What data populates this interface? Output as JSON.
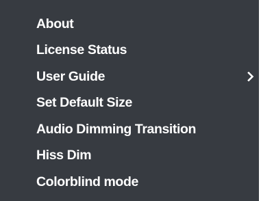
{
  "menu": {
    "items": [
      {
        "label": "About",
        "has_submenu": false
      },
      {
        "label": "License Status",
        "has_submenu": false
      },
      {
        "label": "User Guide",
        "has_submenu": true,
        "submenu_icon": "chevron-right-icon"
      },
      {
        "label": "Set Default Size",
        "has_submenu": false
      },
      {
        "label": "Audio Dimming Transition",
        "has_submenu": false
      },
      {
        "label": "Hiss Dim",
        "has_submenu": false
      },
      {
        "label": "Colorblind mode",
        "has_submenu": false
      }
    ]
  },
  "colors": {
    "menu_background": "#373b41",
    "text": "#ffffff"
  }
}
